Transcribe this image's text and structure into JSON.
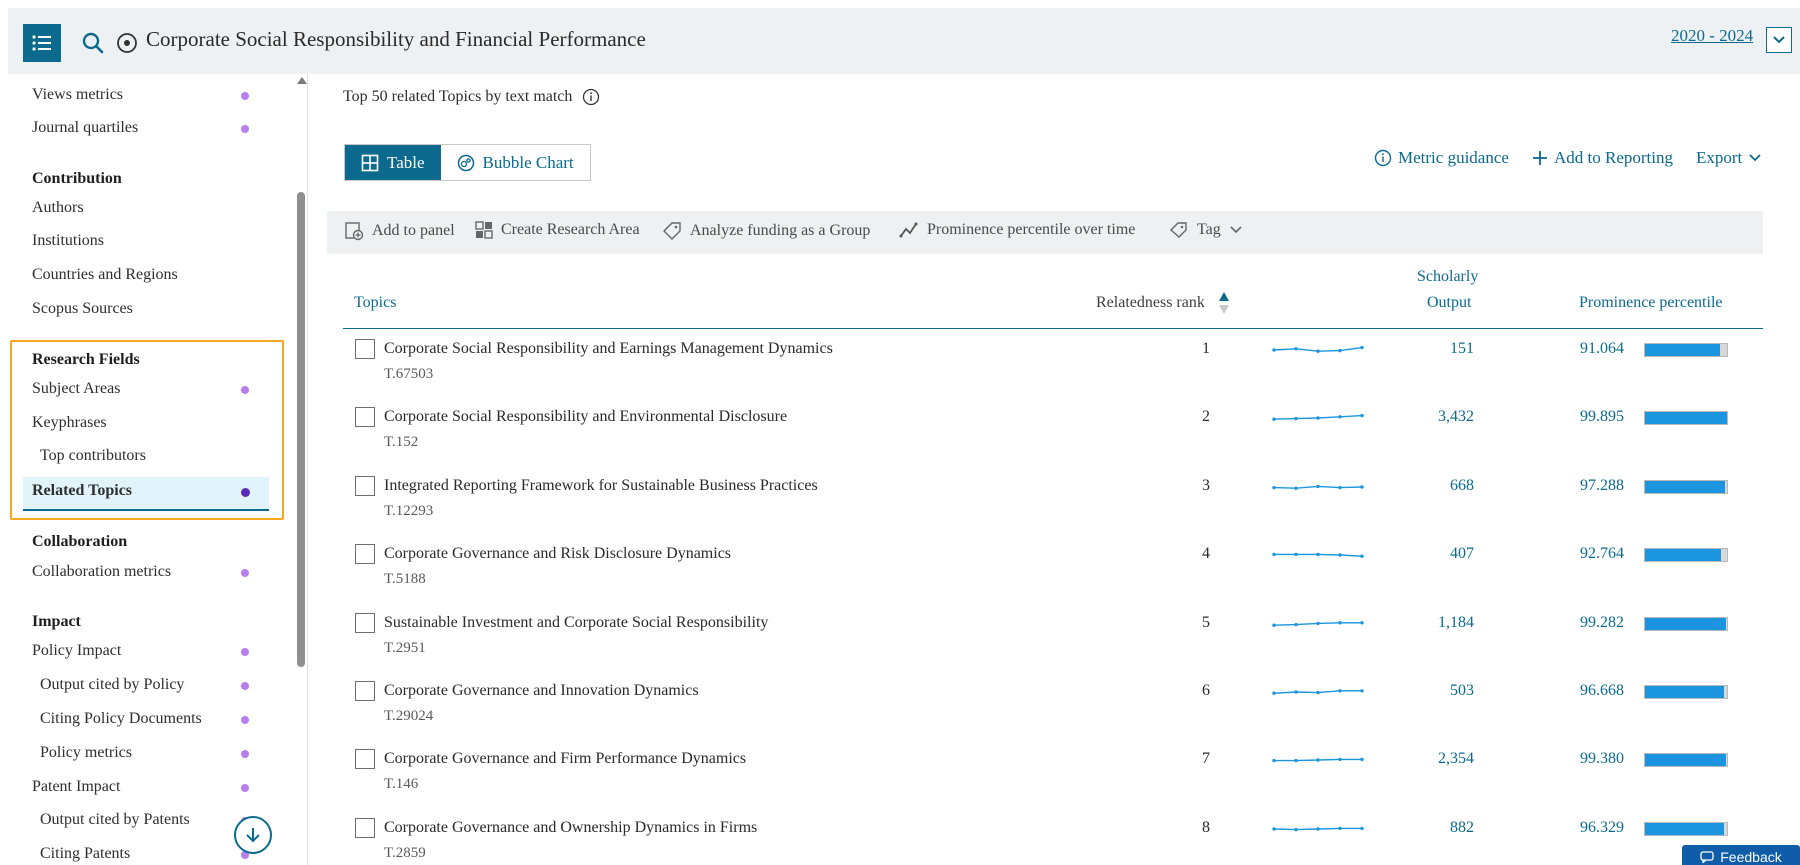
{
  "header": {
    "title": "Corporate Social Responsibility and Financial Performance",
    "date_range": "2020 - 2024"
  },
  "sidebar": {
    "items_top": [
      {
        "label": "Views metrics",
        "dot": true
      },
      {
        "label": "Journal quartiles",
        "dot": true
      }
    ],
    "contribution": {
      "heading": "Contribution",
      "items": [
        "Authors",
        "Institutions",
        "Countries and Regions",
        "Scopus Sources"
      ]
    },
    "research_fields": {
      "heading": "Research Fields",
      "items": [
        {
          "label": "Subject Areas",
          "dot": true
        },
        {
          "label": "Keyphrases",
          "dot": false
        },
        {
          "label": "Top contributors",
          "dot": false
        },
        {
          "label": "Related Topics",
          "dot": true,
          "active": true
        }
      ]
    },
    "collaboration": {
      "heading": "Collaboration",
      "items": [
        {
          "label": "Collaboration metrics",
          "dot": true
        }
      ]
    },
    "impact": {
      "heading": "Impact",
      "items": [
        {
          "label": "Policy Impact",
          "dot": true
        },
        {
          "label": "Output cited by Policy",
          "dot": true
        },
        {
          "label": "Citing Policy Documents",
          "dot": true
        },
        {
          "label": "Policy metrics",
          "dot": true
        },
        {
          "label": "Patent Impact",
          "dot": true
        },
        {
          "label": "Output cited by Patents",
          "dot": true
        },
        {
          "label": "Citing Patents",
          "dot": true
        }
      ]
    }
  },
  "main": {
    "heading": "Top 50 related Topics by text match",
    "view_toggle": {
      "table": "Table",
      "bubble": "Bubble Chart"
    },
    "actions": {
      "metric_guidance": "Metric guidance",
      "add_to_reporting": "Add to Reporting",
      "export": "Export"
    },
    "toolbar": {
      "add_to_panel": "Add to panel",
      "create_research_area": "Create Research Area",
      "analyze_funding": "Analyze funding as a Group",
      "prominence_over_time": "Prominence percentile over time",
      "tag": "Tag"
    },
    "table": {
      "col_topics": "Topics",
      "col_rank": "Relatedness rank",
      "col_output_1": "Scholarly",
      "col_output_2": "Output",
      "col_prominence": "Prominence percentile",
      "rows": [
        {
          "title": "Corporate Social Responsibility and Earnings Management Dynamics",
          "id": "T.67503",
          "rank": "1",
          "output": "151",
          "prominence": "91.064",
          "pct": 0.91064
        },
        {
          "title": "Corporate Social Responsibility and Environmental Disclosure",
          "id": "T.152",
          "rank": "2",
          "output": "3,432",
          "prominence": "99.895",
          "pct": 0.99895
        },
        {
          "title": "Integrated Reporting Framework for Sustainable Business Practices",
          "id": "T.12293",
          "rank": "3",
          "output": "668",
          "prominence": "97.288",
          "pct": 0.97288
        },
        {
          "title": "Corporate Governance and Risk Disclosure Dynamics",
          "id": "T.5188",
          "rank": "4",
          "output": "407",
          "prominence": "92.764",
          "pct": 0.92764
        },
        {
          "title": "Sustainable Investment and Corporate Social Responsibility",
          "id": "T.2951",
          "rank": "5",
          "output": "1,184",
          "prominence": "99.282",
          "pct": 0.99282
        },
        {
          "title": "Corporate Governance and Innovation Dynamics",
          "id": "T.29024",
          "rank": "6",
          "output": "503",
          "prominence": "96.668",
          "pct": 0.96668
        },
        {
          "title": "Corporate Governance and Firm Performance Dynamics",
          "id": "T.146",
          "rank": "7",
          "output": "2,354",
          "prominence": "99.380",
          "pct": 0.9938
        },
        {
          "title": "Corporate Governance and Ownership Dynamics in Firms",
          "id": "T.2859",
          "rank": "8",
          "output": "882",
          "prominence": "96.329",
          "pct": 0.96329
        }
      ]
    }
  },
  "feedback": "Feedback",
  "colors": {
    "accent": "#0b6a8e",
    "bar": "#1b95e0",
    "highlight": "#f5a623",
    "dot": "#b77ef0"
  }
}
